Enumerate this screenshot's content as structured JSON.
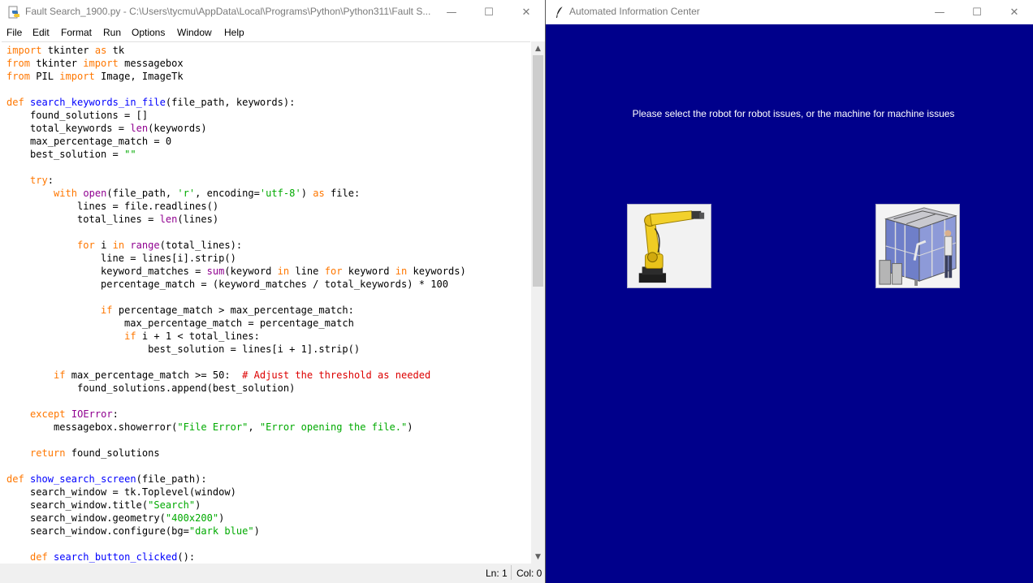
{
  "idle": {
    "title": "Fault Search_1900.py - C:\\Users\\tycmu\\AppData\\Local\\Programs\\Python\\Python311\\Fault S...",
    "window_buttons": {
      "minimize": "—",
      "maximize": "☐",
      "close": "✕"
    },
    "menu": [
      "File",
      "Edit",
      "Format",
      "Run",
      "Options",
      "Window",
      "Help"
    ],
    "code_lines": [
      "import tkinter as tk",
      "from tkinter import messagebox",
      "from PIL import Image, ImageTk",
      "",
      "def search_keywords_in_file(file_path, keywords):",
      "    found_solutions = []",
      "    total_keywords = len(keywords)",
      "    max_percentage_match = 0",
      "    best_solution = \"\"",
      "",
      "    try:",
      "        with open(file_path, 'r', encoding='utf-8') as file:",
      "            lines = file.readlines()",
      "            total_lines = len(lines)",
      "",
      "            for i in range(total_lines):",
      "                line = lines[i].strip()",
      "                keyword_matches = sum(keyword in line for keyword in keywords)",
      "                percentage_match = (keyword_matches / total_keywords) * 100",
      "",
      "                if percentage_match > max_percentage_match:",
      "                    max_percentage_match = percentage_match",
      "                    if i + 1 < total_lines:",
      "                        best_solution = lines[i + 1].strip()",
      "",
      "        if max_percentage_match >= 50:  # Adjust the threshold as needed",
      "            found_solutions.append(best_solution)",
      "",
      "    except IOError:",
      "        messagebox.showerror(\"File Error\", \"Error opening the file.\")",
      "",
      "    return found_solutions",
      "",
      "def show_search_screen(file_path):",
      "    search_window = tk.Toplevel(window)",
      "    search_window.title(\"Search\")",
      "    search_window.geometry(\"400x200\")",
      "    search_window.configure(bg=\"dark blue\")",
      "",
      "    def search_button_clicked():"
    ],
    "status": {
      "line": "Ln: 1",
      "col": "Col: 0"
    },
    "scroll_position": 0
  },
  "app": {
    "title": "Automated Information Center",
    "window_buttons": {
      "minimize": "—",
      "maximize": "☐",
      "close": "✕"
    },
    "prompt": "Please select the robot for robot issues, or the machine for machine issues",
    "background_color": "#00008b",
    "buttons": [
      {
        "name": "robot-button",
        "icon": "industrial-robot-arm-icon"
      },
      {
        "name": "machine-button",
        "icon": "machine-cell-icon"
      }
    ]
  },
  "syntax_colors": {
    "keyword": "#ff7700",
    "builtin": "#900090",
    "definition": "#0000ff",
    "string": "#00aa00",
    "comment": "#dd0000"
  }
}
